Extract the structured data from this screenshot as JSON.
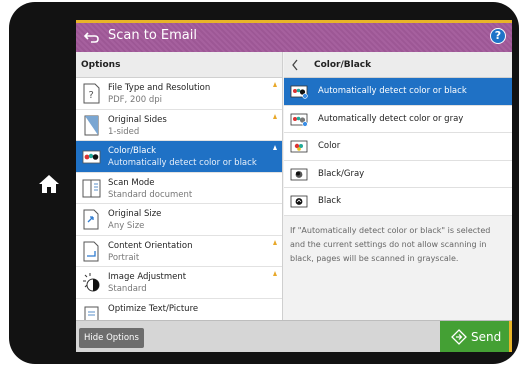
{
  "title_bar": {
    "title": "Scan to Email",
    "help_label": "?"
  },
  "options_panel": {
    "header": "Options",
    "items": [
      {
        "title": "File Type and Resolution",
        "subtitle": "PDF, 200 dpi",
        "icon": "file-type-icon",
        "selected": false
      },
      {
        "title": "Original Sides",
        "subtitle": "1-sided",
        "icon": "original-sides-icon",
        "selected": false
      },
      {
        "title": "Color/Black",
        "subtitle": "Automatically detect color or black",
        "icon": "color-black-icon",
        "selected": true
      },
      {
        "title": "Scan Mode",
        "subtitle": "Standard document",
        "icon": "scan-mode-icon",
        "selected": false
      },
      {
        "title": "Original Size",
        "subtitle": "Any Size",
        "icon": "original-size-icon",
        "selected": false
      },
      {
        "title": "Content Orientation",
        "subtitle": "Portrait",
        "icon": "orientation-icon",
        "selected": false
      },
      {
        "title": "Image Adjustment",
        "subtitle": "Standard",
        "icon": "image-adjustment-icon",
        "selected": false
      },
      {
        "title": "Optimize Text/Picture",
        "subtitle": "",
        "icon": "optimize-icon",
        "selected": false
      }
    ]
  },
  "detail_panel": {
    "header": "Color/Black",
    "choices": [
      {
        "label": "Automatically detect color or black",
        "icon": "auto-color-black-icon",
        "selected": true
      },
      {
        "label": "Automatically detect color or gray",
        "icon": "auto-color-gray-icon",
        "selected": false
      },
      {
        "label": "Color",
        "icon": "color-icon",
        "selected": false
      },
      {
        "label": "Black/Gray",
        "icon": "black-gray-icon",
        "selected": false
      },
      {
        "label": "Black",
        "icon": "black-icon",
        "selected": false
      }
    ],
    "note": "If \"Automatically detect color or black\" is selected and the current settings do not allow scanning in black, pages will be scanned in grayscale."
  },
  "bottom_bar": {
    "hide_options_label": "Hide Options",
    "send_label": "Send"
  },
  "colors": {
    "title_bar": "#a25a9a",
    "selection": "#1f71c5",
    "send_button": "#44a034",
    "warning": "#e8a82a",
    "accent_border": "#e8b428"
  }
}
